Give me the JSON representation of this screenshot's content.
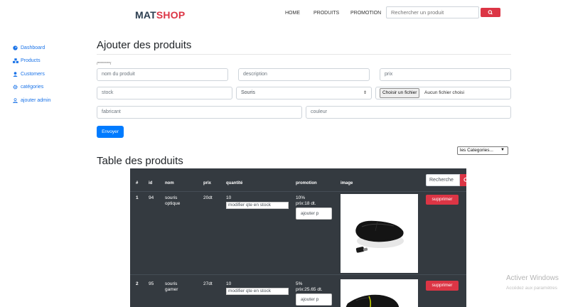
{
  "navbar": {
    "brand_part1": "MAT",
    "brand_part2": "SHOP",
    "links": [
      "HOME",
      "PRODUITS",
      "PROMOTION"
    ],
    "search_placeholder": "Rechercher un produit",
    "search_icon": "search-icon",
    "accent_color": "#dc3545"
  },
  "sidebar": {
    "items": [
      {
        "label": "Dashboard",
        "icon": "dashboard-icon"
      },
      {
        "label": "Products",
        "icon": "products-icon"
      },
      {
        "label": "Customers",
        "icon": "user-icon"
      },
      {
        "label": "catégories",
        "icon": "gear-icon"
      },
      {
        "label": "ajouter admin",
        "icon": "user-outline-icon"
      }
    ]
  },
  "form": {
    "title": "Ajouter des produits",
    "note": "/*********/",
    "nom_placeholder": "nom du produit",
    "description_placeholder": "description",
    "prix_placeholder": "prix",
    "stock_placeholder": "stock",
    "category_selected": "Souris",
    "file_button": "Choisir un fichier",
    "file_status": "Aucun fichier choisi",
    "fabricant_placeholder": "fabricant",
    "couleur_placeholder": "couleur",
    "submit": "Envoyer"
  },
  "filter": {
    "category_selected": "les Categories..."
  },
  "table": {
    "title": "Table des produits",
    "headers": [
      "#",
      "id",
      "nom",
      "prix",
      "quantité",
      "promotion",
      "image"
    ],
    "search_value": "Recherche",
    "stock_placeholder": "modifier qte en stock",
    "promo_button": "ajouter p",
    "delete_label": "supprimer",
    "rows": [
      {
        "num": "1",
        "id": "94",
        "nom_line1": "souris",
        "nom_line2": "optique",
        "prix": "20dt",
        "quantite": "10",
        "promo_pct": "10%",
        "promo_price": "prix:18 dt."
      },
      {
        "num": "2",
        "id": "95",
        "nom_line1": "souris",
        "nom_line2": "gamer",
        "prix": "27dt",
        "quantite": "10",
        "promo_pct": "5%",
        "promo_price": "prix:25.65 dt."
      }
    ]
  },
  "watermark": {
    "line1": "Activer Windows",
    "line2": "Accédez aux paramètres"
  }
}
